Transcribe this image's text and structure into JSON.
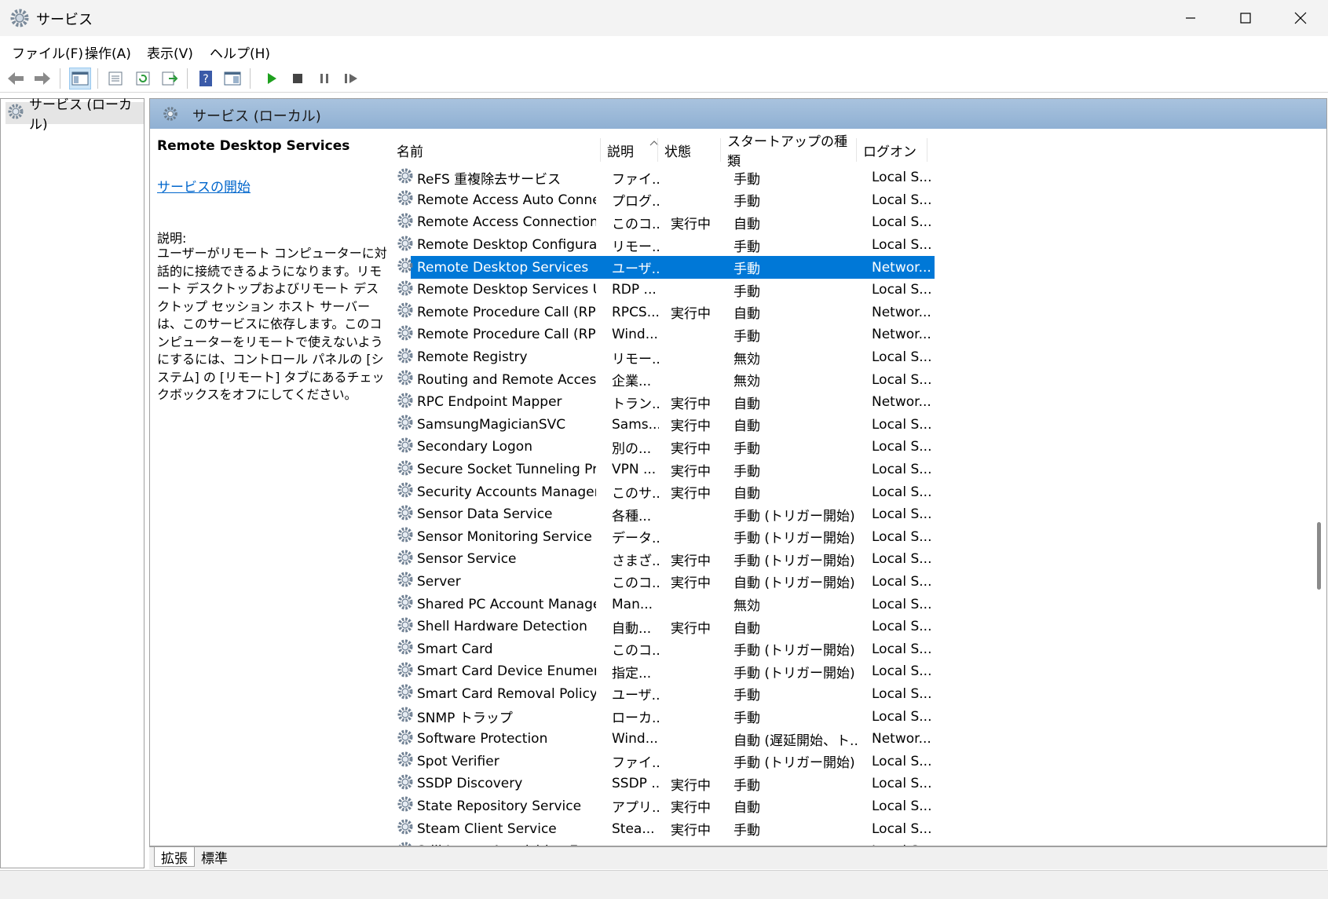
{
  "window": {
    "title": "サービス"
  },
  "menu": [
    "ファイル(F)",
    "操作(A)",
    "表示(V)",
    "ヘルプ(H)"
  ],
  "tree": {
    "root": "サービス (ローカル)"
  },
  "header": {
    "title": "サービス (ローカル)"
  },
  "detail": {
    "service_name": "Remote Desktop Services",
    "start_link": "サービスの開始",
    "desc_label": "説明:",
    "description": "ユーザーがリモート コンピューターに対話的に接続できるようになります。リモート デスクトップおよびリモート デスクトップ セッション ホスト サーバーは、このサービスに依存します。このコンピューターをリモートで使えないようにするには、コントロール パネルの [システム] の [リモート] タブにあるチェックボックスをオフにしてください。"
  },
  "columns": {
    "name": "名前",
    "desc": "説明",
    "status": "状態",
    "startup": "スタートアップの種類",
    "logon": "ログオン"
  },
  "services": [
    {
      "name": "ReFS 重複除去サービス",
      "desc": "ファイ...",
      "status": "",
      "startup": "手動",
      "logon": "Local S..."
    },
    {
      "name": "Remote Access Auto Connec...",
      "desc": "プログ...",
      "status": "",
      "startup": "手動",
      "logon": "Local S..."
    },
    {
      "name": "Remote Access Connection ...",
      "desc": "このコ...",
      "status": "実行中",
      "startup": "自動",
      "logon": "Local S..."
    },
    {
      "name": "Remote Desktop Configurati...",
      "desc": "リモー...",
      "status": "",
      "startup": "手動",
      "logon": "Local S..."
    },
    {
      "name": "Remote Desktop Services",
      "desc": "ユーザ...",
      "status": "",
      "startup": "手動",
      "logon": "Networ...",
      "selected": true
    },
    {
      "name": "Remote Desktop Services Us...",
      "desc": "RDP ...",
      "status": "",
      "startup": "手動",
      "logon": "Local S..."
    },
    {
      "name": "Remote Procedure Call (RPC)",
      "desc": "RPCS...",
      "status": "実行中",
      "startup": "自動",
      "logon": "Networ..."
    },
    {
      "name": "Remote Procedure Call (RPC)...",
      "desc": "Wind...",
      "status": "",
      "startup": "手動",
      "logon": "Networ..."
    },
    {
      "name": "Remote Registry",
      "desc": "リモー...",
      "status": "",
      "startup": "無効",
      "logon": "Local S..."
    },
    {
      "name": "Routing and Remote Access",
      "desc": "企業...",
      "status": "",
      "startup": "無効",
      "logon": "Local S..."
    },
    {
      "name": "RPC Endpoint Mapper",
      "desc": "トラン...",
      "status": "実行中",
      "startup": "自動",
      "logon": "Networ..."
    },
    {
      "name": "SamsungMagicianSVC",
      "desc": "Sams...",
      "status": "実行中",
      "startup": "自動",
      "logon": "Local S..."
    },
    {
      "name": "Secondary Logon",
      "desc": "別の...",
      "status": "実行中",
      "startup": "手動",
      "logon": "Local S..."
    },
    {
      "name": "Secure Socket Tunneling Pro...",
      "desc": "VPN ...",
      "status": "実行中",
      "startup": "手動",
      "logon": "Local S..."
    },
    {
      "name": "Security Accounts Manager",
      "desc": "このサ...",
      "status": "実行中",
      "startup": "自動",
      "logon": "Local S..."
    },
    {
      "name": "Sensor Data Service",
      "desc": "各種...",
      "status": "",
      "startup": "手動 (トリガー開始)",
      "logon": "Local S..."
    },
    {
      "name": "Sensor Monitoring Service",
      "desc": "データ...",
      "status": "",
      "startup": "手動 (トリガー開始)",
      "logon": "Local S..."
    },
    {
      "name": "Sensor Service",
      "desc": "さまざ...",
      "status": "実行中",
      "startup": "手動 (トリガー開始)",
      "logon": "Local S..."
    },
    {
      "name": "Server",
      "desc": "このコ...",
      "status": "実行中",
      "startup": "自動 (トリガー開始)",
      "logon": "Local S..."
    },
    {
      "name": "Shared PC Account Manager",
      "desc": "Man...",
      "status": "",
      "startup": "無効",
      "logon": "Local S..."
    },
    {
      "name": "Shell Hardware Detection",
      "desc": "自動...",
      "status": "実行中",
      "startup": "自動",
      "logon": "Local S..."
    },
    {
      "name": "Smart Card",
      "desc": "このコ...",
      "status": "",
      "startup": "手動 (トリガー開始)",
      "logon": "Local S..."
    },
    {
      "name": "Smart Card Device Enumerat...",
      "desc": "指定...",
      "status": "",
      "startup": "手動 (トリガー開始)",
      "logon": "Local S..."
    },
    {
      "name": "Smart Card Removal Policy",
      "desc": "ユーザ...",
      "status": "",
      "startup": "手動",
      "logon": "Local S..."
    },
    {
      "name": "SNMP トラップ",
      "desc": "ローカ...",
      "status": "",
      "startup": "手動",
      "logon": "Local S..."
    },
    {
      "name": "Software Protection",
      "desc": "Wind...",
      "status": "",
      "startup": "自動 (遅延開始、ト...",
      "logon": "Networ..."
    },
    {
      "name": "Spot Verifier",
      "desc": "ファイ...",
      "status": "",
      "startup": "手動 (トリガー開始)",
      "logon": "Local S..."
    },
    {
      "name": "SSDP Discovery",
      "desc": "SSDP ...",
      "status": "実行中",
      "startup": "手動",
      "logon": "Local S..."
    },
    {
      "name": "State Repository Service",
      "desc": "アプリ...",
      "status": "実行中",
      "startup": "自動",
      "logon": "Local S..."
    },
    {
      "name": "Steam Client Service",
      "desc": "Stea...",
      "status": "実行中",
      "startup": "手動",
      "logon": "Local S..."
    },
    {
      "name": "Still Image Acquisition Events",
      "desc": "静止...",
      "status": "",
      "startup": "手動",
      "logon": "Local S..."
    }
  ],
  "tabs": [
    "拡張",
    "標準"
  ],
  "colors": {
    "selection": "#0078d7",
    "header_band": "#9fbadb",
    "link": "#0066cc"
  }
}
